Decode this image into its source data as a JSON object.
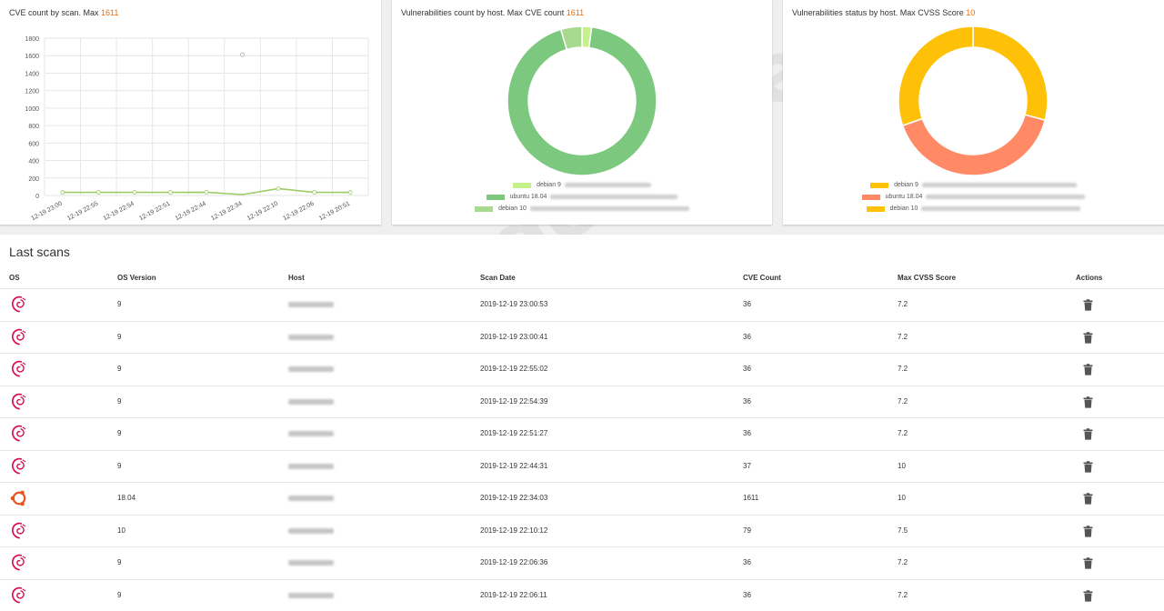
{
  "cve_card": {
    "title": "CVE count by scan. Max ",
    "max": "1611"
  },
  "vuln_card": {
    "title": "Vulnerabilities count by host. Max CVE count ",
    "max": "1611",
    "legend": [
      {
        "label": "debian 9",
        "color": "#c5f08a"
      },
      {
        "label": "ubuntu 18.04",
        "color": "#7cc87e"
      },
      {
        "label": "debian 10",
        "color": "#a7d98f"
      }
    ]
  },
  "status_card": {
    "title": "Vulnerabilities status by host. Max CVSS Score ",
    "max": "10",
    "legend": [
      {
        "label": "debian 9",
        "color": "#ffc107"
      },
      {
        "label": "ubuntu 18.04",
        "color": "#ff8a65"
      },
      {
        "label": "debian 10",
        "color": "#ffc107"
      }
    ]
  },
  "chart_data": [
    {
      "type": "line",
      "x": [
        "12-19 23:00",
        "12-19 22:55",
        "12-19 22:54",
        "12-19 22:51",
        "12-19 22:44",
        "12-19 22:34",
        "12-19 22:10",
        "12-19 22:06",
        "12-19 20:51"
      ],
      "series": [
        {
          "values": [
            36,
            36,
            36,
            36,
            37,
            1611,
            79,
            36,
            36
          ],
          "color": "#9ccc65"
        }
      ],
      "yticks": [
        "0",
        "200",
        "400",
        "600",
        "800",
        "1000",
        "1200",
        "1400",
        "1600",
        "1800"
      ],
      "ylim": [
        0,
        1800
      ],
      "grid": true
    },
    {
      "type": "pie",
      "categories": [
        "debian 9",
        "ubuntu 18.04",
        "debian 10"
      ],
      "values": [
        36,
        1611,
        79
      ],
      "colors": [
        "#c5f08a",
        "#7cc87e",
        "#a7d98f"
      ]
    },
    {
      "type": "pie",
      "categories": [
        "debian 9",
        "ubuntu 18.04",
        "debian 10"
      ],
      "values": [
        7.2,
        10,
        7.5
      ],
      "colors": [
        "#ffc107",
        "#ff8a65",
        "#ffc107"
      ]
    }
  ],
  "scans": {
    "title": "Last scans",
    "headers": {
      "os": "OS",
      "os_version": "OS Version",
      "host": "Host",
      "scan_date": "Scan Date",
      "cve_count": "CVE Count",
      "max_cvss": "Max CVSS Score",
      "actions": "Actions"
    },
    "rows": [
      {
        "os": "debian",
        "version": "9",
        "date": "2019-12-19 23:00:53",
        "cve": "36",
        "cvss": "7.2"
      },
      {
        "os": "debian",
        "version": "9",
        "date": "2019-12-19 23:00:41",
        "cve": "36",
        "cvss": "7.2"
      },
      {
        "os": "debian",
        "version": "9",
        "date": "2019-12-19 22:55:02",
        "cve": "36",
        "cvss": "7.2"
      },
      {
        "os": "debian",
        "version": "9",
        "date": "2019-12-19 22:54:39",
        "cve": "36",
        "cvss": "7.2"
      },
      {
        "os": "debian",
        "version": "9",
        "date": "2019-12-19 22:51:27",
        "cve": "36",
        "cvss": "7.2"
      },
      {
        "os": "debian",
        "version": "9",
        "date": "2019-12-19 22:44:31",
        "cve": "37",
        "cvss": "10"
      },
      {
        "os": "ubuntu",
        "version": "18.04",
        "date": "2019-12-19 22:34:03",
        "cve": "1611",
        "cvss": "10"
      },
      {
        "os": "debian",
        "version": "10",
        "date": "2019-12-19 22:10:12",
        "cve": "79",
        "cvss": "7.5"
      },
      {
        "os": "debian",
        "version": "9",
        "date": "2019-12-19 22:06:36",
        "cve": "36",
        "cvss": "7.2"
      },
      {
        "os": "debian",
        "version": "9",
        "date": "2019-12-19 22:06:11",
        "cve": "36",
        "cvss": "7.2"
      }
    ]
  },
  "watermark": "codeby.net"
}
